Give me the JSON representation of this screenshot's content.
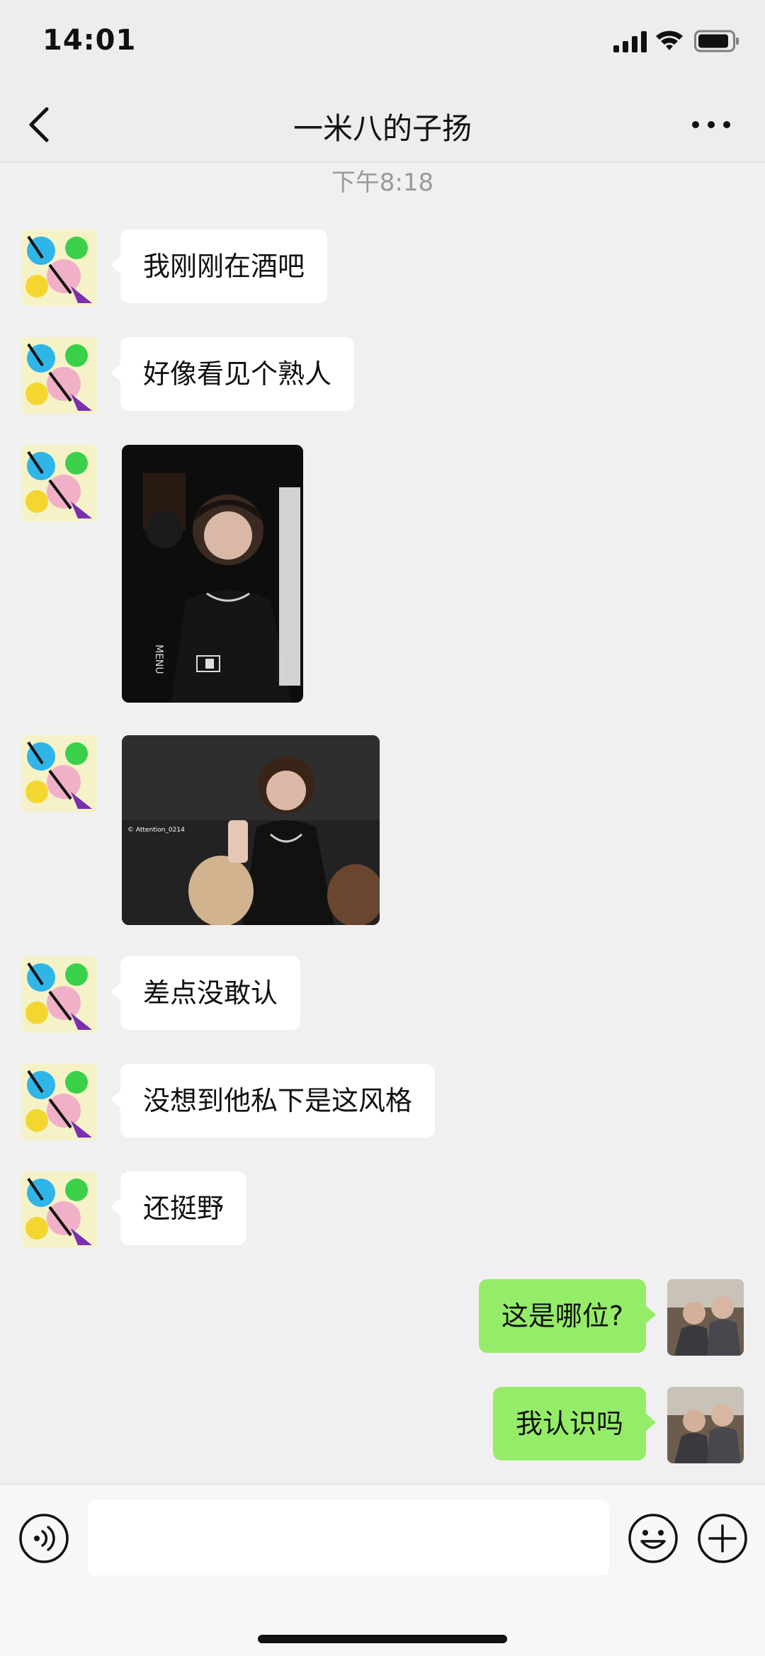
{
  "status_bar": {
    "time": "14:01"
  },
  "header": {
    "title": "一米八的子扬"
  },
  "chat": {
    "timestamp": "下午8:18",
    "messages": [
      {
        "side": "in",
        "type": "text",
        "text": "我刚刚在酒吧"
      },
      {
        "side": "in",
        "type": "text",
        "text": "好像看见个熟人"
      },
      {
        "side": "in",
        "type": "image",
        "image_texts": [
          "MENU"
        ]
      },
      {
        "side": "in",
        "type": "image",
        "image_texts": [
          "© Attention_0214"
        ]
      },
      {
        "side": "in",
        "type": "text",
        "text": "差点没敢认"
      },
      {
        "side": "in",
        "type": "text",
        "text": "没想到他私下是这风格"
      },
      {
        "side": "in",
        "type": "text",
        "text": "还挺野"
      },
      {
        "side": "out",
        "type": "text",
        "text": "这是哪位?"
      },
      {
        "side": "out",
        "type": "text",
        "text": "我认识吗"
      }
    ]
  },
  "input_bar": {
    "value": ""
  },
  "icons": [
    "signal-icon",
    "wifi-icon",
    "battery-icon",
    "back-icon",
    "more-icon",
    "voice-icon",
    "emoji-icon",
    "plus-icon"
  ],
  "colors": {
    "background": "#ededed",
    "incoming_bubble": "#ffffff",
    "outgoing_bubble": "#95ec69"
  }
}
